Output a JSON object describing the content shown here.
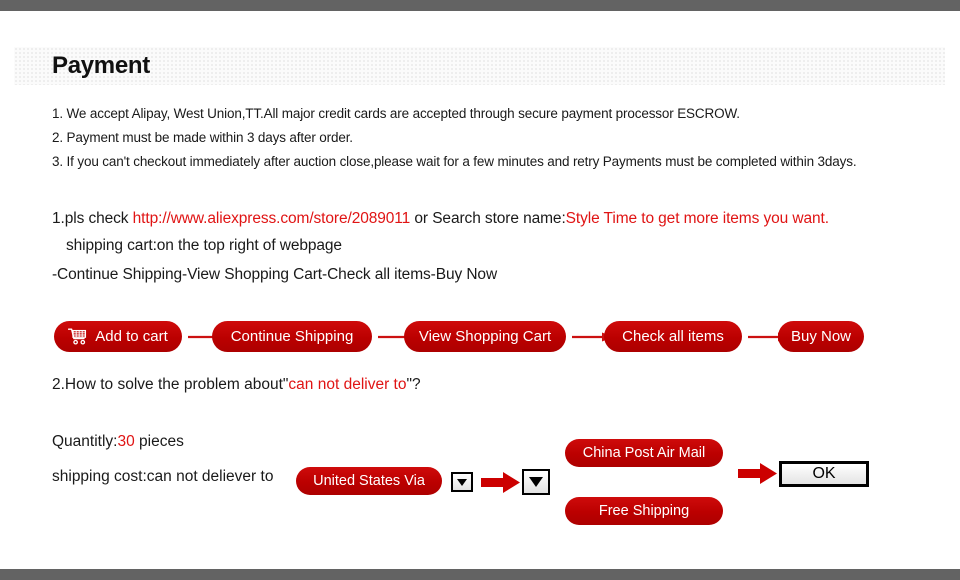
{
  "header": {
    "title": "Payment"
  },
  "notes": [
    "1. We accept Alipay, West Union,TT.All major credit cards are accepted through secure payment processor ESCROW.",
    "2. Payment must be made within 3 days after order.",
    "3. If you can't checkout immediately after auction close,please wait for a few minutes and retry Payments must be completed within 3days."
  ],
  "store_line": {
    "prefix": "1.pls check ",
    "url": "http://www.aliexpress.com/store/2089011",
    "middle": " or Search store name:",
    "store_name_suffix": "Style Time to get more items you want."
  },
  "cart_hint": "shipping cart:on the top right of webpage",
  "flow_text": "-Continue Shipping-View Shopping Cart-Check all items-Buy Now",
  "flow_buttons": [
    {
      "label": "Add to cart",
      "icon": "shopping-cart-icon"
    },
    {
      "label": "Continue Shipping",
      "icon": ""
    },
    {
      "label": "View Shopping Cart",
      "icon": ""
    },
    {
      "label": "Check all items",
      "icon": ""
    },
    {
      "label": "Buy Now",
      "icon": ""
    }
  ],
  "question": {
    "prefix": "2.How to solve the problem about\"",
    "highlight": "can not deliver to",
    "suffix": "\"?"
  },
  "quantity": {
    "label": "Quantitly:",
    "value": "30",
    "unit": " pieces"
  },
  "shipping": {
    "label": "shipping cost:can not deliever to",
    "country_pill": "United States Via",
    "option_1": "China Post Air Mail",
    "option_2": "Free Shipping",
    "ok_label": "OK"
  },
  "colors": {
    "pill_red": "#c00000",
    "accent_red": "#e01414",
    "edge_bar_gray": "#636363",
    "block_arrow_red": "#cc0000"
  }
}
